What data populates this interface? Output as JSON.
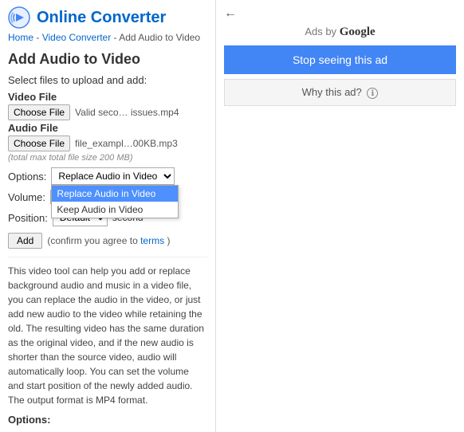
{
  "header": {
    "logo_alt": "Online Converter logo",
    "site_name": "Online Converter"
  },
  "breadcrumb": {
    "home": "Home",
    "video_converter": "Video Converter",
    "current": "Add Audio to Video",
    "separator": " - "
  },
  "page": {
    "title": "Add Audio to Video",
    "subtitle": "Select files to upload and add:"
  },
  "video_file": {
    "label": "Video File",
    "btn_label": "Choose File",
    "file_info": "Valid seco… issues.mp4"
  },
  "audio_file": {
    "label": "Audio File",
    "btn_label": "Choose File",
    "file_info": "file_exampl…00KB.mp3"
  },
  "max_size": "(total max total file size 200 MB)",
  "options": {
    "label": "Options:",
    "selected": "Replace Audio in Video",
    "dropdown_items": [
      {
        "label": "Replace Audio in Video",
        "selected": true
      },
      {
        "label": "Keep Audio in Video",
        "selected": false
      }
    ]
  },
  "volume": {
    "label": "Volume:",
    "value": ""
  },
  "position": {
    "label": "Position:",
    "selected_option": "Default",
    "options": [
      "Default"
    ],
    "second_label": "second"
  },
  "add_btn": {
    "label": "Add",
    "confirm_text": "(confirm you agree to",
    "terms_text": "terms",
    "confirm_end": ")"
  },
  "description": "This video tool can help you add or replace background audio and music in a video file, you can replace the audio in the video, or just add new audio to the video while retaining the old. The resulting video has the same duration as the original video, and if the new audio is shorter than the source video, audio will automatically loop. You can set the volume and start position of the newly added audio. The output format is MP4 format.",
  "options_heading": "Options:",
  "ads": {
    "ads_by_label": "Ads by",
    "google_label": "Google",
    "stop_ad_label": "Stop seeing this ad",
    "why_ad_label": "Why this ad?",
    "info_icon": "ℹ"
  },
  "back_arrow": "←"
}
